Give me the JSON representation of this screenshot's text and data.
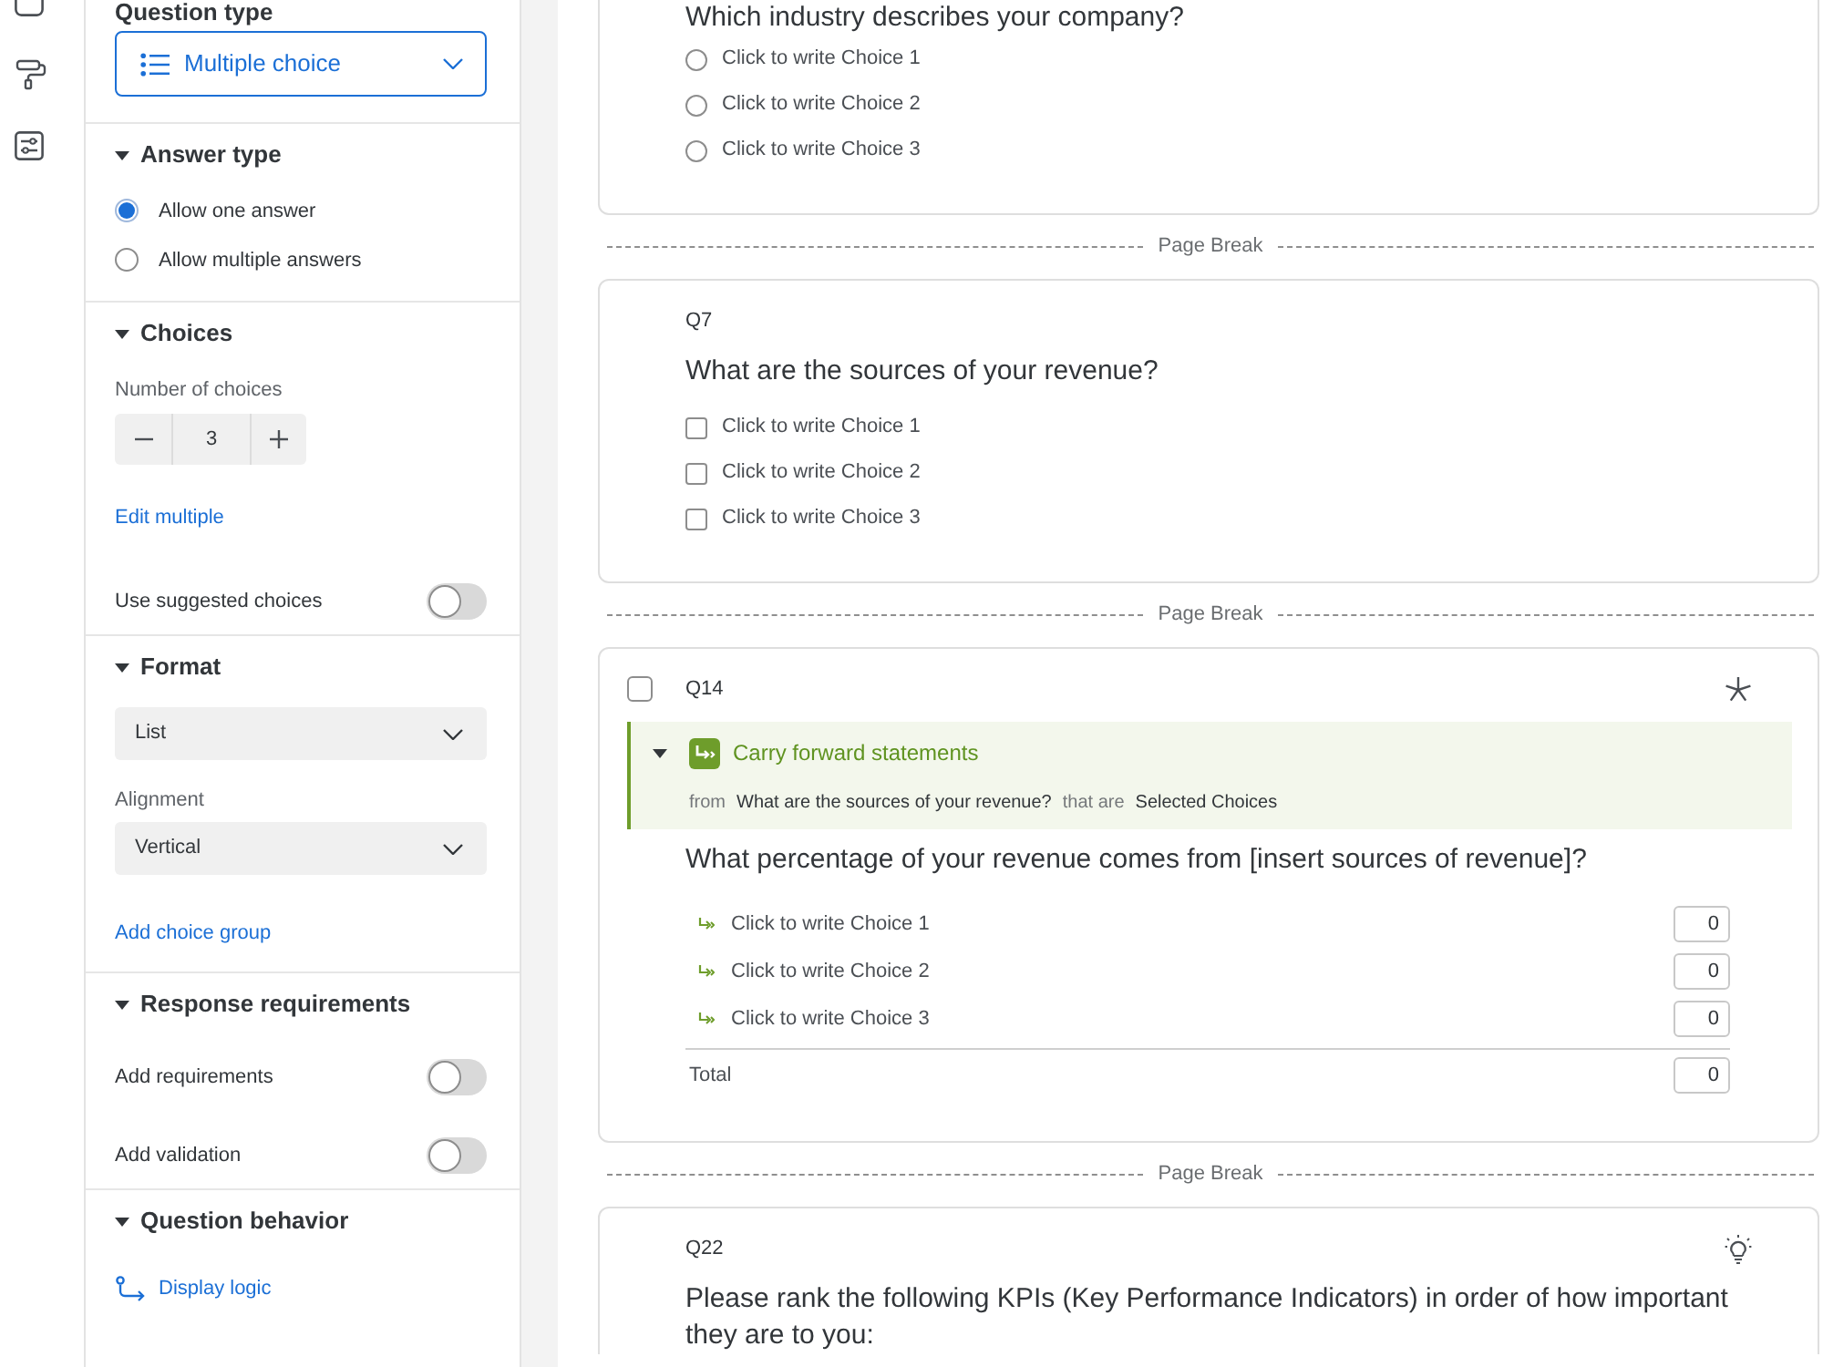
{
  "sidebar": {
    "question_type": {
      "label": "Question type",
      "value": "Multiple choice"
    },
    "sections": [
      {
        "title": "Answer type",
        "expanded": true,
        "items": [
          {
            "kind": "radio",
            "label": "Allow one answer",
            "selected": true
          },
          {
            "kind": "radio",
            "label": "Allow multiple answers",
            "selected": false
          }
        ]
      },
      {
        "title": "Choices",
        "expanded": true,
        "items": [
          {
            "kind": "stepper",
            "label": "Number of choices",
            "value": "3"
          },
          {
            "kind": "link",
            "label": "Edit multiple"
          },
          {
            "kind": "toggle",
            "label": "Use suggested choices",
            "on": false
          }
        ]
      },
      {
        "title": "Format",
        "expanded": true,
        "items": [
          {
            "kind": "select",
            "value": "List"
          },
          {
            "kind": "select",
            "label": "Alignment",
            "value": "Vertical"
          },
          {
            "kind": "link",
            "label": "Add choice group"
          }
        ]
      },
      {
        "title": "Response requirements",
        "expanded": true,
        "items": [
          {
            "kind": "toggle",
            "label": "Add requirements",
            "on": false
          },
          {
            "kind": "toggle",
            "label": "Add validation",
            "on": false
          }
        ]
      },
      {
        "title": "Question behavior",
        "expanded": true,
        "items": [
          {
            "kind": "logic_link",
            "label": "Display logic"
          }
        ]
      }
    ]
  },
  "main": {
    "blocks": [
      {
        "kind": "question",
        "text": "Which industry describes your company?",
        "answers": {
          "kind": "radio",
          "choices": [
            {
              "label": "Click to write Choice 1",
              "selected": false
            },
            {
              "label": "Click to write Choice 2",
              "selected": false
            },
            {
              "label": "Click to write Choice 3",
              "selected": false
            }
          ]
        }
      },
      {
        "kind": "page_break",
        "label": "Page Break"
      },
      {
        "kind": "question",
        "number": "Q7",
        "text": "What are the sources of your revenue?",
        "answers": {
          "kind": "checkbox",
          "choices": [
            {
              "label": "Click to write Choice 1",
              "checked": false
            },
            {
              "label": "Click to write Choice 2",
              "checked": false
            },
            {
              "label": "Click to write Choice 3",
              "checked": false
            }
          ]
        }
      },
      {
        "kind": "page_break",
        "label": "Page Break"
      },
      {
        "kind": "question",
        "number": "Q14",
        "select_box": {
          "checked": false
        },
        "required": true,
        "carry_forward": {
          "title": "Carry forward statements",
          "expanded": true,
          "from_label": "from",
          "source": "What are the sources of your revenue?",
          "that_label": "that are",
          "filter": "Selected Choices"
        },
        "text": "What percentage of your revenue comes from [insert sources of revenue]?",
        "answers": {
          "kind": "constant_sum",
          "choices": [
            {
              "label": "Click to write Choice 1",
              "value": "0"
            },
            {
              "label": "Click to write Choice 2",
              "value": "0"
            },
            {
              "label": "Click to write Choice 3",
              "value": "0"
            }
          ],
          "total": {
            "label": "Total",
            "value": "0"
          }
        }
      },
      {
        "kind": "page_break",
        "label": "Page Break"
      },
      {
        "kind": "question",
        "number": "Q22",
        "recommendation": true,
        "text": "Please rank the following KPIs (Key Performance Indicators) in order of how important they are to you:"
      }
    ]
  }
}
